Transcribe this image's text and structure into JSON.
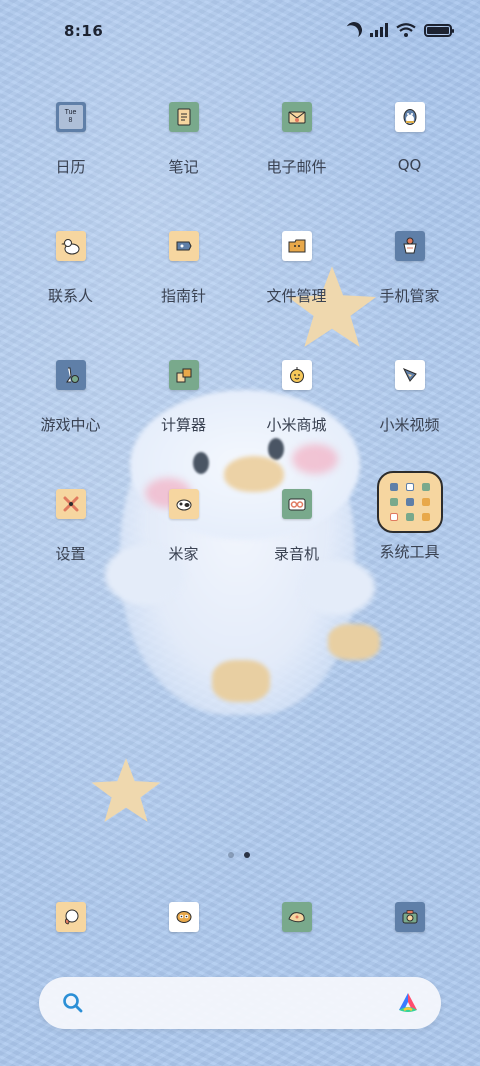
{
  "status_bar": {
    "time": "8:16",
    "icons": [
      "moon-icon",
      "signal-icon",
      "wifi-icon",
      "battery-icon"
    ],
    "battery_level": 1.0
  },
  "apps": [
    {
      "label": "日历",
      "icon": "calendar-icon",
      "bg": "#5f7fa8",
      "calendar_day": "Tue",
      "calendar_date": "8"
    },
    {
      "label": "笔记",
      "icon": "notes-icon",
      "bg": "#79a98c"
    },
    {
      "label": "电子邮件",
      "icon": "email-icon",
      "bg": "#79a98c"
    },
    {
      "label": "QQ",
      "icon": "qq-icon",
      "bg": "#ffffff"
    },
    {
      "label": "联系人",
      "icon": "contacts-icon",
      "bg": "#f6d6a0"
    },
    {
      "label": "指南针",
      "icon": "compass-icon",
      "bg": "#f6d6a0"
    },
    {
      "label": "文件管理",
      "icon": "file-manager-icon",
      "bg": "#ffffff"
    },
    {
      "label": "手机管家",
      "icon": "security-icon",
      "bg": "#5f7fa8"
    },
    {
      "label": "游戏中心",
      "icon": "game-center-icon",
      "bg": "#5f7fa8"
    },
    {
      "label": "计算器",
      "icon": "calculator-icon",
      "bg": "#79a98c"
    },
    {
      "label": "小米商城",
      "icon": "mi-store-icon",
      "bg": "#ffffff"
    },
    {
      "label": "小米视频",
      "icon": "mi-video-icon",
      "bg": "#ffffff"
    },
    {
      "label": "设置",
      "icon": "settings-icon",
      "bg": "#f6d6a0"
    },
    {
      "label": "米家",
      "icon": "mi-home-icon",
      "bg": "#f6d6a0"
    },
    {
      "label": "录音机",
      "icon": "recorder-icon",
      "bg": "#79a98c"
    }
  ],
  "folder": {
    "label": "系统工具",
    "icon": "folder-icon",
    "bg": "#f6d6a0"
  },
  "page_indicator": {
    "total": 2,
    "current": 2
  },
  "dock": [
    {
      "icon": "phone-icon",
      "bg": "#f6d6a0"
    },
    {
      "icon": "messages-icon",
      "bg": "#ffffff"
    },
    {
      "icon": "browser-icon",
      "bg": "#79a98c"
    },
    {
      "icon": "camera-icon",
      "bg": "#5f7fa8"
    }
  ],
  "search_bar": {
    "left_icon": "search-icon",
    "right_icon": "assistant-icon",
    "accent": "#2b8fd6"
  }
}
